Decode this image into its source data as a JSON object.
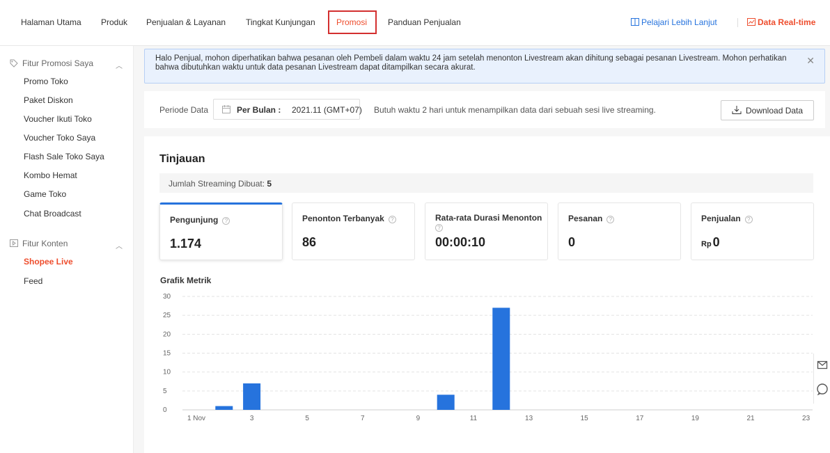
{
  "nav": {
    "items": [
      "Halaman Utama",
      "Produk",
      "Penjualan & Layanan",
      "Tingkat Kunjungan",
      "Promosi",
      "Panduan Penjualan"
    ],
    "learn_more": "Pelajari Lebih Lanjut",
    "realtime": "Data Real-time",
    "accent": "#ee4d2d",
    "link_color": "#2673dd"
  },
  "sidebar": {
    "group1": "Fitur Promosi Saya",
    "group1_items": [
      "Promo Toko",
      "Paket Diskon",
      "Voucher Ikuti Toko",
      "Voucher Toko Saya",
      "Flash Sale Toko Saya",
      "Kombo Hemat",
      "Game Toko",
      "Chat Broadcast"
    ],
    "group2": "Fitur Konten",
    "group2_items": [
      "Shopee Live",
      "Feed"
    ],
    "active_item": "Shopee Live"
  },
  "notice": {
    "text": "Halo Penjual, mohon diperhatikan bahwa pesanan oleh Pembeli dalam waktu 24 jam setelah menonton Livestream akan dihitung sebagai pesanan Livestream. Mohon perhatikan bahwa dibutuhkan waktu untuk data pesanan Livestream dapat ditampilkan secara akurat."
  },
  "period": {
    "label": "Periode Data",
    "kind": "Per Bulan :",
    "value": "2021.11 (GMT+07)",
    "hint": "Butuh waktu 2 hari untuk menampilkan data dari sebuah sesi live streaming.",
    "download": "Download Data"
  },
  "overview": {
    "title": "Tinjauan",
    "streams_label": "Jumlah Streaming Dibuat:",
    "streams_value": "5",
    "cards": [
      {
        "name": "Pengunjung",
        "value": "1.174",
        "prefix": ""
      },
      {
        "name": "Penonton Terbanyak",
        "value": "86",
        "prefix": ""
      },
      {
        "name": "Rata-rata Durasi Menonton",
        "value": "00:00:10",
        "prefix": ""
      },
      {
        "name": "Pesanan",
        "value": "0",
        "prefix": ""
      },
      {
        "name": "Penjualan",
        "value": "0",
        "prefix": "Rp"
      }
    ],
    "chart_title": "Grafik Metrik"
  },
  "chart_data": {
    "type": "bar",
    "title": "Grafik Metrik",
    "xlabel": "",
    "ylabel": "",
    "ylim": [
      0,
      30
    ],
    "yticks": [
      0,
      5,
      10,
      15,
      20,
      25,
      30
    ],
    "categories": [
      "1",
      "2",
      "3",
      "4",
      "5",
      "6",
      "7",
      "8",
      "9",
      "10",
      "11",
      "12",
      "13",
      "14",
      "15",
      "16",
      "17",
      "18",
      "19",
      "20",
      "21",
      "22",
      "23"
    ],
    "tick_labels": [
      "1 Nov",
      "3",
      "5",
      "7",
      "9",
      "11",
      "13",
      "15",
      "17",
      "19",
      "21",
      "23"
    ],
    "values": [
      0,
      1,
      7,
      0,
      0,
      0,
      0,
      0,
      0,
      4,
      0,
      27,
      0,
      0,
      0,
      0,
      0,
      0,
      0,
      0,
      0,
      0,
      0
    ],
    "bar_color": "#2673dd",
    "grid": true
  }
}
